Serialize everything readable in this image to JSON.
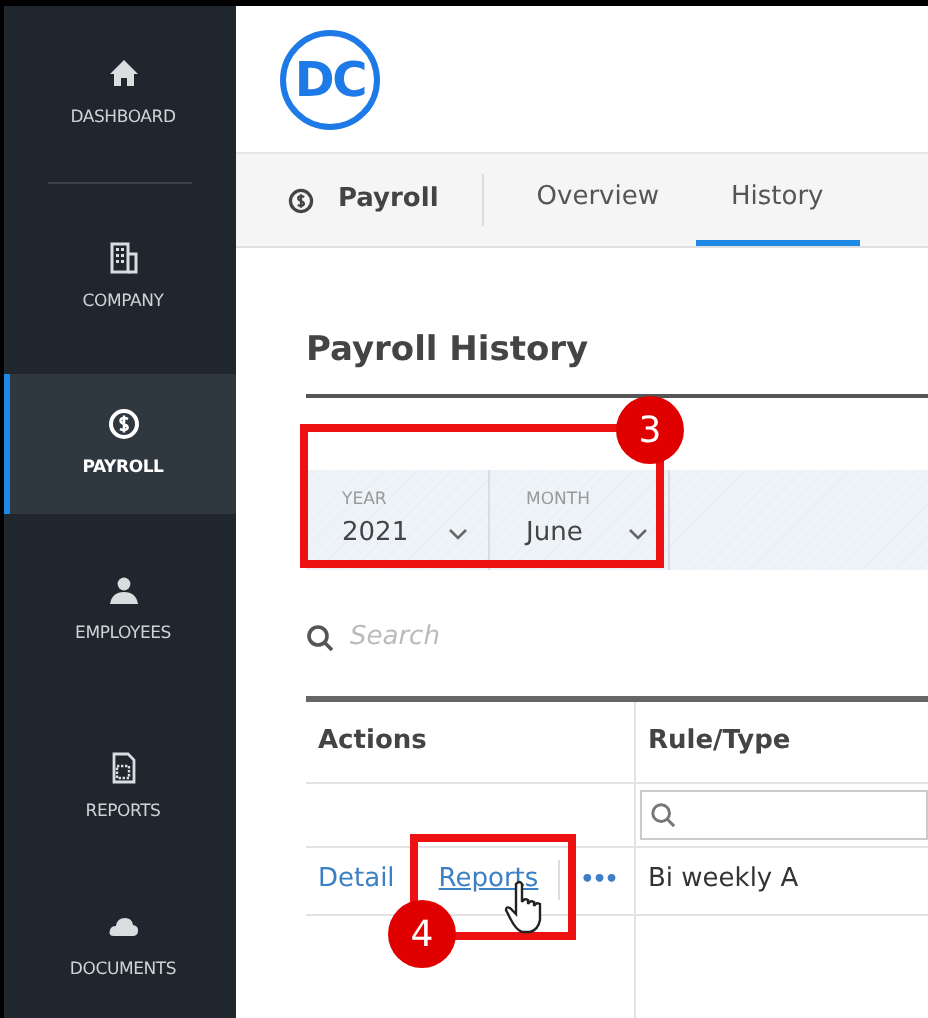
{
  "sidebar": {
    "items": [
      {
        "label": "DASHBOARD",
        "kind": "home",
        "selected": false
      },
      {
        "label": "COMPANY",
        "kind": "building",
        "selected": false
      },
      {
        "label": "PAYROLL",
        "kind": "dollar",
        "selected": true
      },
      {
        "label": "EMPLOYEES",
        "kind": "person",
        "selected": false
      },
      {
        "label": "REPORTS",
        "kind": "report",
        "selected": false
      },
      {
        "label": "DOCUMENTS",
        "kind": "cloud",
        "selected": false
      }
    ]
  },
  "header": {
    "logo_text": "DC"
  },
  "subnav": {
    "section": "Payroll",
    "tabs": [
      {
        "label": "Overview",
        "selected": false
      },
      {
        "label": "History",
        "selected": true
      }
    ]
  },
  "page_title": "Payroll History",
  "filters": [
    {
      "label": "YEAR",
      "value": "2021"
    },
    {
      "label": "MONTH",
      "value": "June"
    }
  ],
  "search": {
    "placeholder": "Search"
  },
  "table": {
    "columns": [
      "Actions",
      "Rule/Type"
    ],
    "rows": [
      {
        "actions": [
          {
            "kind": "link",
            "label": "Detail"
          },
          {
            "kind": "underlined_link",
            "label": "Reports"
          },
          {
            "kind": "more",
            "label": "•••"
          }
        ],
        "rule_type": "Bi weekly A"
      }
    ]
  },
  "annotations": [
    {
      "number": "3"
    },
    {
      "number": "4"
    }
  ]
}
